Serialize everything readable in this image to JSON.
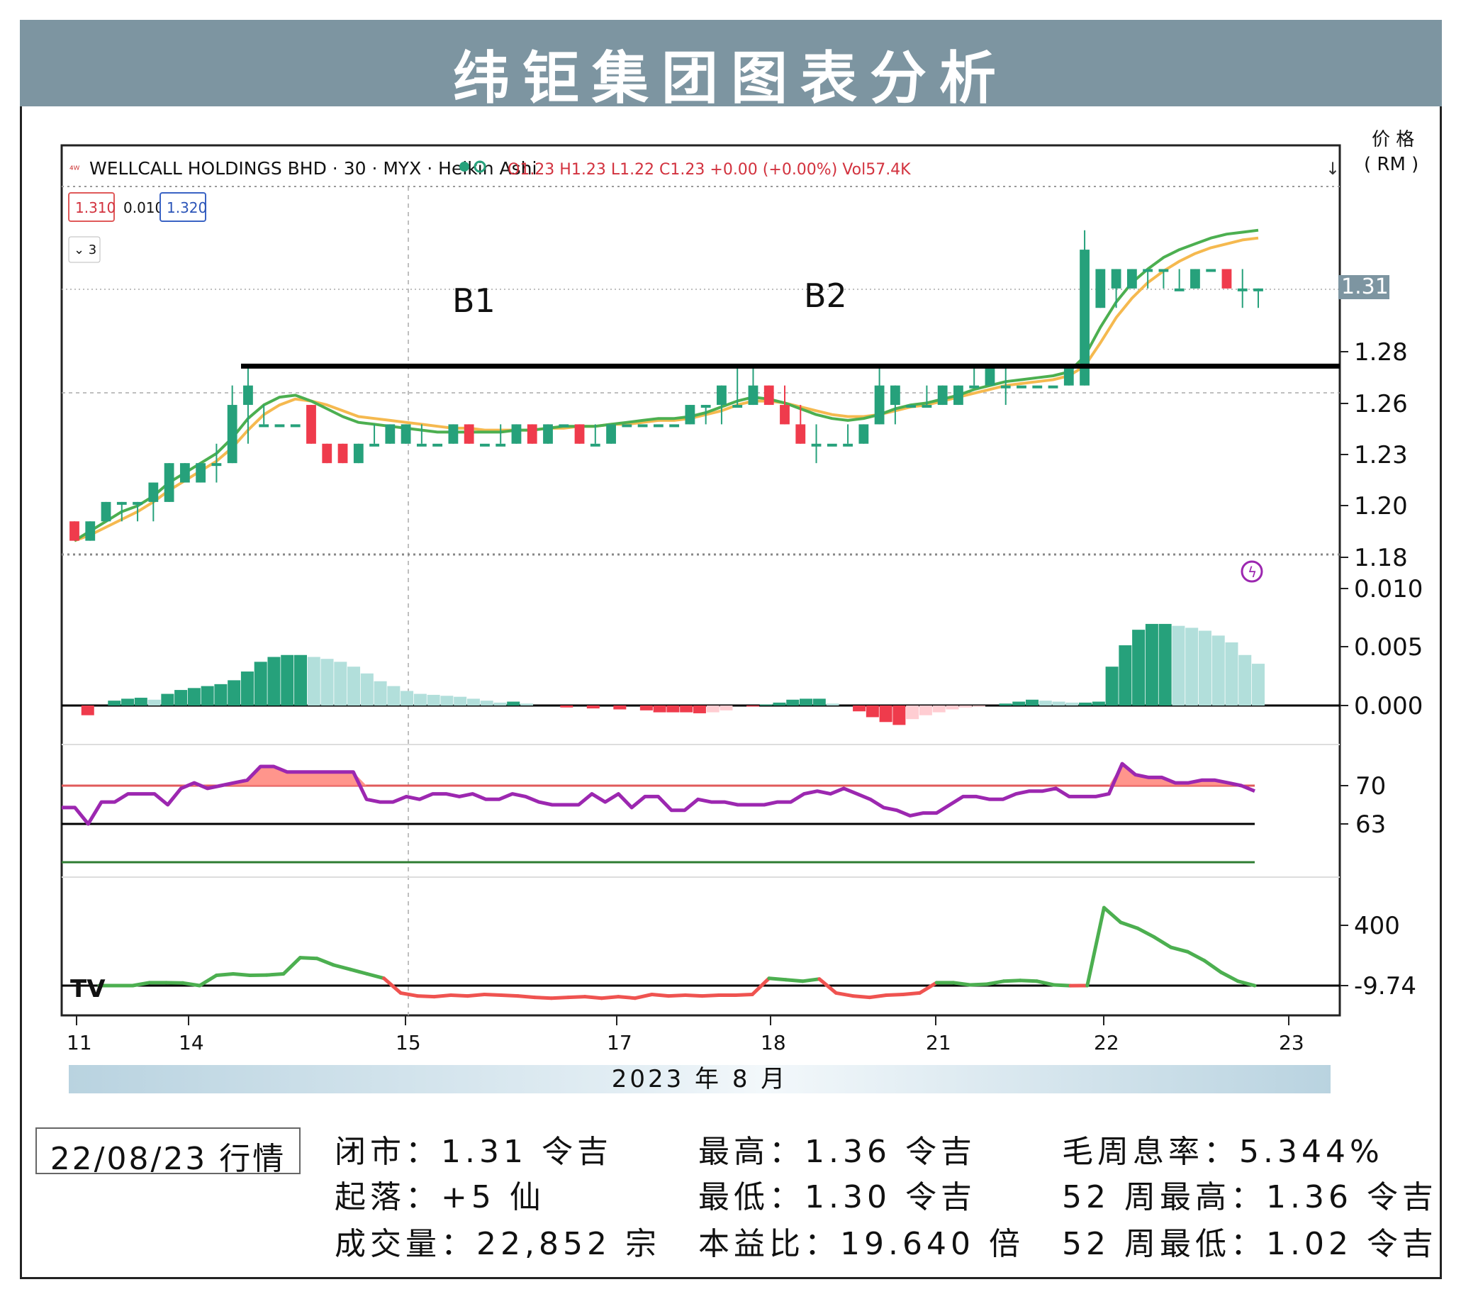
{
  "title": "纬钜集团图表分析",
  "unit_label": [
    "价 格",
    "( RM )"
  ],
  "header": {
    "symbol": "WELLCALL HOLDINGS BHD · 30 · MYX · Heikin Ashi",
    "ohlc": "O1.23 H1.23 L1.22 C1.23 +0.00 (+0.00%) Vol57.4K",
    "bid": "1.310",
    "spread": "0.010",
    "ask": "1.320",
    "indicator_count": "3"
  },
  "annotations": {
    "b1": "B1",
    "b2": "B2"
  },
  "current_price_tag": "1.31",
  "price_axis": [
    "1.28",
    "1.26",
    "1.23",
    "1.20",
    "1.18"
  ],
  "macd_axis": [
    "0.010",
    "0.005",
    "0.000"
  ],
  "rsi_axis": [
    "70",
    "63"
  ],
  "osc_axis": [
    "400",
    "-9.74"
  ],
  "x_axis": [
    "11",
    "14",
    "15",
    "17",
    "18",
    "21",
    "22",
    "23"
  ],
  "x_caption": "2023 年 8 月",
  "colors": {
    "up": "#26a17b",
    "down": "#ef3b4c",
    "ma_fast": "#4caf50",
    "ma_slow": "#f5b94f",
    "rsi": "#9c27b0",
    "header_bg": "#7d95a1"
  },
  "date_label": "22/08/23 行情",
  "stats": {
    "close": "闭市：1.31 令吉",
    "change": "起落：+5 仙",
    "volume": "成交量：22,852 宗",
    "high": "最高：1.36 令吉",
    "low": "最低：1.30 令吉",
    "pe": "本益比：19.640 倍",
    "yield": "毛周息率：5.344%",
    "high52": "52 周最高：1.36 令吉",
    "low52": "52 周最低：1.02 令吉"
  },
  "chart_data": {
    "type": "candlestick",
    "title": "WELLCALL HOLDINGS BHD · 30 · MYX · Heikin Ashi",
    "resistance_level": 1.27,
    "ylim": [
      1.17,
      1.36
    ],
    "candles": [
      [
        1.19,
        1.19,
        1.18,
        1.18
      ],
      [
        1.18,
        1.19,
        1.18,
        1.19
      ],
      [
        1.19,
        1.2,
        1.19,
        1.2
      ],
      [
        1.2,
        1.2,
        1.19,
        1.2
      ],
      [
        1.2,
        1.2,
        1.19,
        1.2
      ],
      [
        1.2,
        1.21,
        1.19,
        1.21
      ],
      [
        1.2,
        1.22,
        1.2,
        1.22
      ],
      [
        1.21,
        1.22,
        1.21,
        1.22
      ],
      [
        1.21,
        1.22,
        1.21,
        1.22
      ],
      [
        1.22,
        1.23,
        1.21,
        1.22
      ],
      [
        1.22,
        1.26,
        1.22,
        1.25
      ],
      [
        1.25,
        1.27,
        1.23,
        1.26
      ],
      [
        1.24,
        1.25,
        1.24,
        1.24
      ],
      [
        1.24,
        1.24,
        1.24,
        1.24
      ],
      [
        1.24,
        1.24,
        1.24,
        1.24
      ],
      [
        1.25,
        1.25,
        1.23,
        1.23
      ],
      [
        1.23,
        1.23,
        1.22,
        1.22
      ],
      [
        1.23,
        1.23,
        1.22,
        1.22
      ],
      [
        1.22,
        1.23,
        1.22,
        1.23
      ],
      [
        1.23,
        1.24,
        1.23,
        1.23
      ],
      [
        1.23,
        1.24,
        1.23,
        1.24
      ],
      [
        1.23,
        1.24,
        1.23,
        1.24
      ],
      [
        1.23,
        1.24,
        1.23,
        1.23
      ],
      [
        1.23,
        1.23,
        1.23,
        1.23
      ],
      [
        1.23,
        1.24,
        1.23,
        1.24
      ],
      [
        1.24,
        1.24,
        1.23,
        1.23
      ],
      [
        1.23,
        1.23,
        1.23,
        1.23
      ],
      [
        1.23,
        1.24,
        1.23,
        1.23
      ],
      [
        1.23,
        1.24,
        1.23,
        1.24
      ],
      [
        1.24,
        1.24,
        1.23,
        1.23
      ],
      [
        1.23,
        1.24,
        1.23,
        1.24
      ],
      [
        1.24,
        1.24,
        1.24,
        1.24
      ],
      [
        1.24,
        1.24,
        1.23,
        1.23
      ],
      [
        1.23,
        1.24,
        1.23,
        1.23
      ],
      [
        1.23,
        1.24,
        1.23,
        1.24
      ],
      [
        1.24,
        1.24,
        1.24,
        1.24
      ],
      [
        1.24,
        1.24,
        1.24,
        1.24
      ],
      [
        1.24,
        1.24,
        1.24,
        1.24
      ],
      [
        1.24,
        1.24,
        1.24,
        1.24
      ],
      [
        1.24,
        1.25,
        1.24,
        1.25
      ],
      [
        1.25,
        1.25,
        1.24,
        1.25
      ],
      [
        1.25,
        1.26,
        1.24,
        1.26
      ],
      [
        1.25,
        1.27,
        1.25,
        1.25
      ],
      [
        1.25,
        1.27,
        1.25,
        1.26
      ],
      [
        1.26,
        1.26,
        1.25,
        1.25
      ],
      [
        1.25,
        1.26,
        1.24,
        1.24
      ],
      [
        1.24,
        1.25,
        1.23,
        1.23
      ],
      [
        1.23,
        1.24,
        1.22,
        1.23
      ],
      [
        1.23,
        1.23,
        1.23,
        1.23
      ],
      [
        1.23,
        1.24,
        1.23,
        1.23
      ],
      [
        1.23,
        1.24,
        1.23,
        1.24
      ],
      [
        1.24,
        1.27,
        1.24,
        1.26
      ],
      [
        1.25,
        1.26,
        1.24,
        1.26
      ],
      [
        1.25,
        1.25,
        1.25,
        1.25
      ],
      [
        1.25,
        1.26,
        1.25,
        1.25
      ],
      [
        1.25,
        1.26,
        1.25,
        1.26
      ],
      [
        1.25,
        1.26,
        1.25,
        1.26
      ],
      [
        1.26,
        1.27,
        1.26,
        1.26
      ],
      [
        1.26,
        1.27,
        1.26,
        1.27
      ],
      [
        1.26,
        1.27,
        1.25,
        1.26
      ],
      [
        1.26,
        1.26,
        1.26,
        1.26
      ],
      [
        1.26,
        1.26,
        1.26,
        1.26
      ],
      [
        1.26,
        1.26,
        1.26,
        1.26
      ],
      [
        1.26,
        1.27,
        1.26,
        1.27
      ],
      [
        1.26,
        1.34,
        1.26,
        1.33
      ],
      [
        1.3,
        1.32,
        1.3,
        1.32
      ],
      [
        1.31,
        1.32,
        1.3,
        1.32
      ],
      [
        1.31,
        1.32,
        1.31,
        1.32
      ],
      [
        1.32,
        1.32,
        1.31,
        1.32
      ],
      [
        1.32,
        1.32,
        1.31,
        1.32
      ],
      [
        1.31,
        1.32,
        1.31,
        1.31
      ],
      [
        1.31,
        1.32,
        1.31,
        1.32
      ],
      [
        1.32,
        1.32,
        1.32,
        1.32
      ],
      [
        1.32,
        1.32,
        1.31,
        1.31
      ],
      [
        1.31,
        1.32,
        1.3,
        1.31
      ],
      [
        1.31,
        1.31,
        1.3,
        1.31
      ]
    ],
    "ma_fast": [
      1.18,
      1.185,
      1.19,
      1.195,
      1.198,
      1.203,
      1.21,
      1.215,
      1.22,
      1.225,
      1.233,
      1.243,
      1.25,
      1.254,
      1.255,
      1.252,
      1.248,
      1.244,
      1.241,
      1.24,
      1.239,
      1.238,
      1.237,
      1.236,
      1.236,
      1.236,
      1.236,
      1.236,
      1.237,
      1.237,
      1.238,
      1.239,
      1.239,
      1.239,
      1.24,
      1.241,
      1.242,
      1.243,
      1.243,
      1.244,
      1.246,
      1.249,
      1.252,
      1.254,
      1.253,
      1.251,
      1.248,
      1.245,
      1.243,
      1.242,
      1.243,
      1.245,
      1.248,
      1.25,
      1.251,
      1.253,
      1.255,
      1.258,
      1.26,
      1.262,
      1.263,
      1.264,
      1.265,
      1.267,
      1.275,
      1.29,
      1.303,
      1.313,
      1.32,
      1.326,
      1.33,
      1.333,
      1.336,
      1.338,
      1.339,
      1.34
    ],
    "ma_slow": [
      1.18,
      1.183,
      1.187,
      1.191,
      1.195,
      1.2,
      1.206,
      1.211,
      1.216,
      1.221,
      1.228,
      1.237,
      1.245,
      1.25,
      1.253,
      1.252,
      1.25,
      1.247,
      1.244,
      1.243,
      1.242,
      1.241,
      1.24,
      1.239,
      1.238,
      1.238,
      1.237,
      1.237,
      1.237,
      1.237,
      1.238,
      1.238,
      1.239,
      1.239,
      1.24,
      1.24,
      1.241,
      1.242,
      1.242,
      1.243,
      1.245,
      1.247,
      1.25,
      1.252,
      1.252,
      1.251,
      1.249,
      1.247,
      1.245,
      1.244,
      1.244,
      1.245,
      1.247,
      1.249,
      1.25,
      1.252,
      1.254,
      1.256,
      1.258,
      1.26,
      1.261,
      1.262,
      1.263,
      1.265,
      1.27,
      1.282,
      1.295,
      1.305,
      1.313,
      1.319,
      1.324,
      1.328,
      1.331,
      1.333,
      1.335,
      1.336
    ],
    "macd_hist": [
      0,
      -0.001,
      0,
      0.0005,
      0.0007,
      0.0008,
      0.0006,
      0.0012,
      0.0016,
      0.0018,
      0.002,
      0.0022,
      0.0026,
      0.0035,
      0.0045,
      0.005,
      0.0052,
      0.0052,
      0.005,
      0.0048,
      0.0045,
      0.004,
      0.0033,
      0.0025,
      0.002,
      0.0015,
      0.0012,
      0.0011,
      0.001,
      0.0009,
      0.0007,
      0.0005,
      0.0003,
      0.0004,
      0.0002,
      0,
      0,
      -0.0002,
      0,
      -0.0003,
      0,
      -0.0004,
      0,
      -0.0005,
      -0.0007,
      -0.0007,
      -0.0007,
      -0.0008,
      -0.0007,
      -0.0005,
      0,
      -0.0001,
      0.0001,
      0.0003,
      0.0006,
      0.0007,
      0.0007,
      0.0002,
      0,
      -0.0006,
      -0.0012,
      -0.0017,
      -0.002,
      -0.0014,
      -0.001,
      -0.0007,
      -0.0004,
      -0.0002,
      -0.0001,
      0,
      0.0002,
      0.0004,
      0.0006,
      0.0005,
      0.0004,
      0.0003,
      0.0003,
      0.0004,
      0.004,
      0.0062,
      0.0078,
      0.0084,
      0.0084,
      0.0082,
      0.008,
      0.0077,
      0.0072,
      0.0065,
      0.0052,
      0.0043
    ],
    "rsi": [
      66,
      66,
      63,
      67,
      67,
      68.5,
      68.5,
      68.5,
      66.5,
      69.5,
      70.5,
      69.5,
      70,
      70.5,
      71,
      73.5,
      73.5,
      72.5,
      72.5,
      72.5,
      72.5,
      72.5,
      72.5,
      67.5,
      67,
      67,
      68,
      67.5,
      68.5,
      68.5,
      68,
      68.5,
      67.5,
      67.5,
      68.5,
      68,
      67,
      66.5,
      66.5,
      66.5,
      68.5,
      67,
      68.5,
      66,
      68,
      68,
      65.5,
      65.5,
      67.5,
      67,
      67,
      66.5,
      66.5,
      66.5,
      67,
      67,
      68.5,
      69,
      68.5,
      69.5,
      68.5,
      67.5,
      66,
      65.5,
      64.5,
      65,
      65,
      66.5,
      68,
      68,
      67.5,
      67.5,
      68.5,
      69,
      69,
      69.5,
      68,
      68,
      68,
      68.5,
      74,
      72,
      71.5,
      71.5,
      70.5,
      70.5,
      71,
      71,
      70.5,
      70,
      69
    ],
    "osc": [
      -9.74,
      -9.74,
      -9.74,
      10,
      10,
      8,
      -9.74,
      60,
      70,
      60,
      62,
      70,
      180,
      175,
      130,
      100,
      70,
      40,
      -60,
      -80,
      -85,
      -75,
      -80,
      -70,
      -75,
      -80,
      -90,
      -95,
      -90,
      -85,
      -95,
      -85,
      -95,
      -70,
      -80,
      -75,
      -80,
      -75,
      -75,
      -70,
      40,
      30,
      20,
      35,
      -60,
      -80,
      -90,
      -75,
      -70,
      -60,
      10,
      10,
      -5,
      0,
      20,
      25,
      20,
      -5,
      -10,
      -9.74,
      520,
      420,
      380,
      320,
      250,
      220,
      160,
      80,
      20,
      -9.74
    ]
  }
}
